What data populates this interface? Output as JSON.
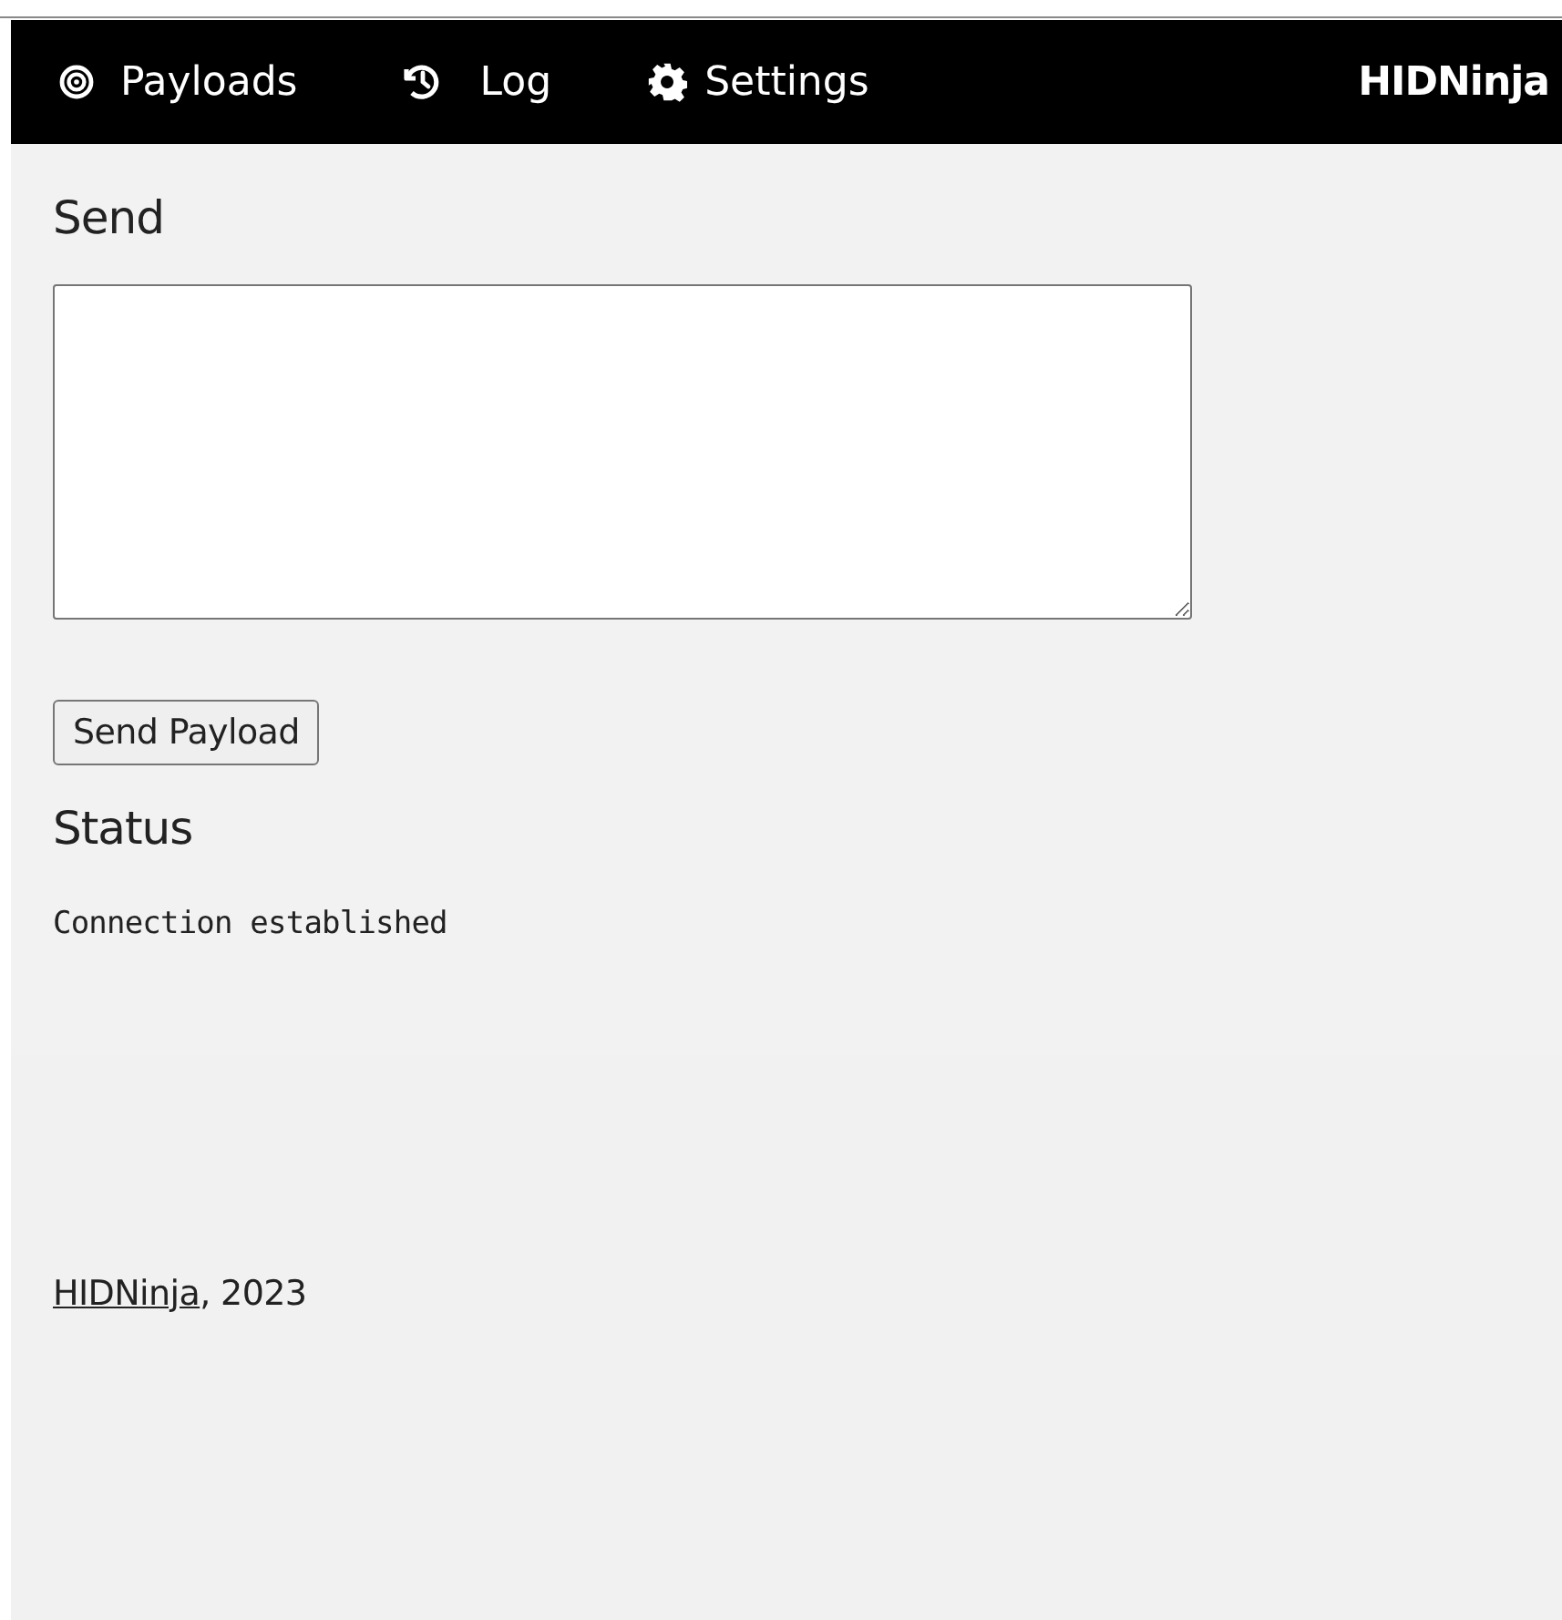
{
  "nav": {
    "items": [
      {
        "kind": "target",
        "label": "Payloads"
      },
      {
        "kind": "history",
        "label": "Log"
      },
      {
        "kind": "gear",
        "label": "Settings"
      }
    ],
    "brand": "HIDNinja"
  },
  "send": {
    "heading": "Send",
    "button": "Send Payload"
  },
  "status": {
    "heading": "Status",
    "message": "Connection established"
  },
  "footer": {
    "link": "HIDNinja",
    "text": ", 2023"
  }
}
